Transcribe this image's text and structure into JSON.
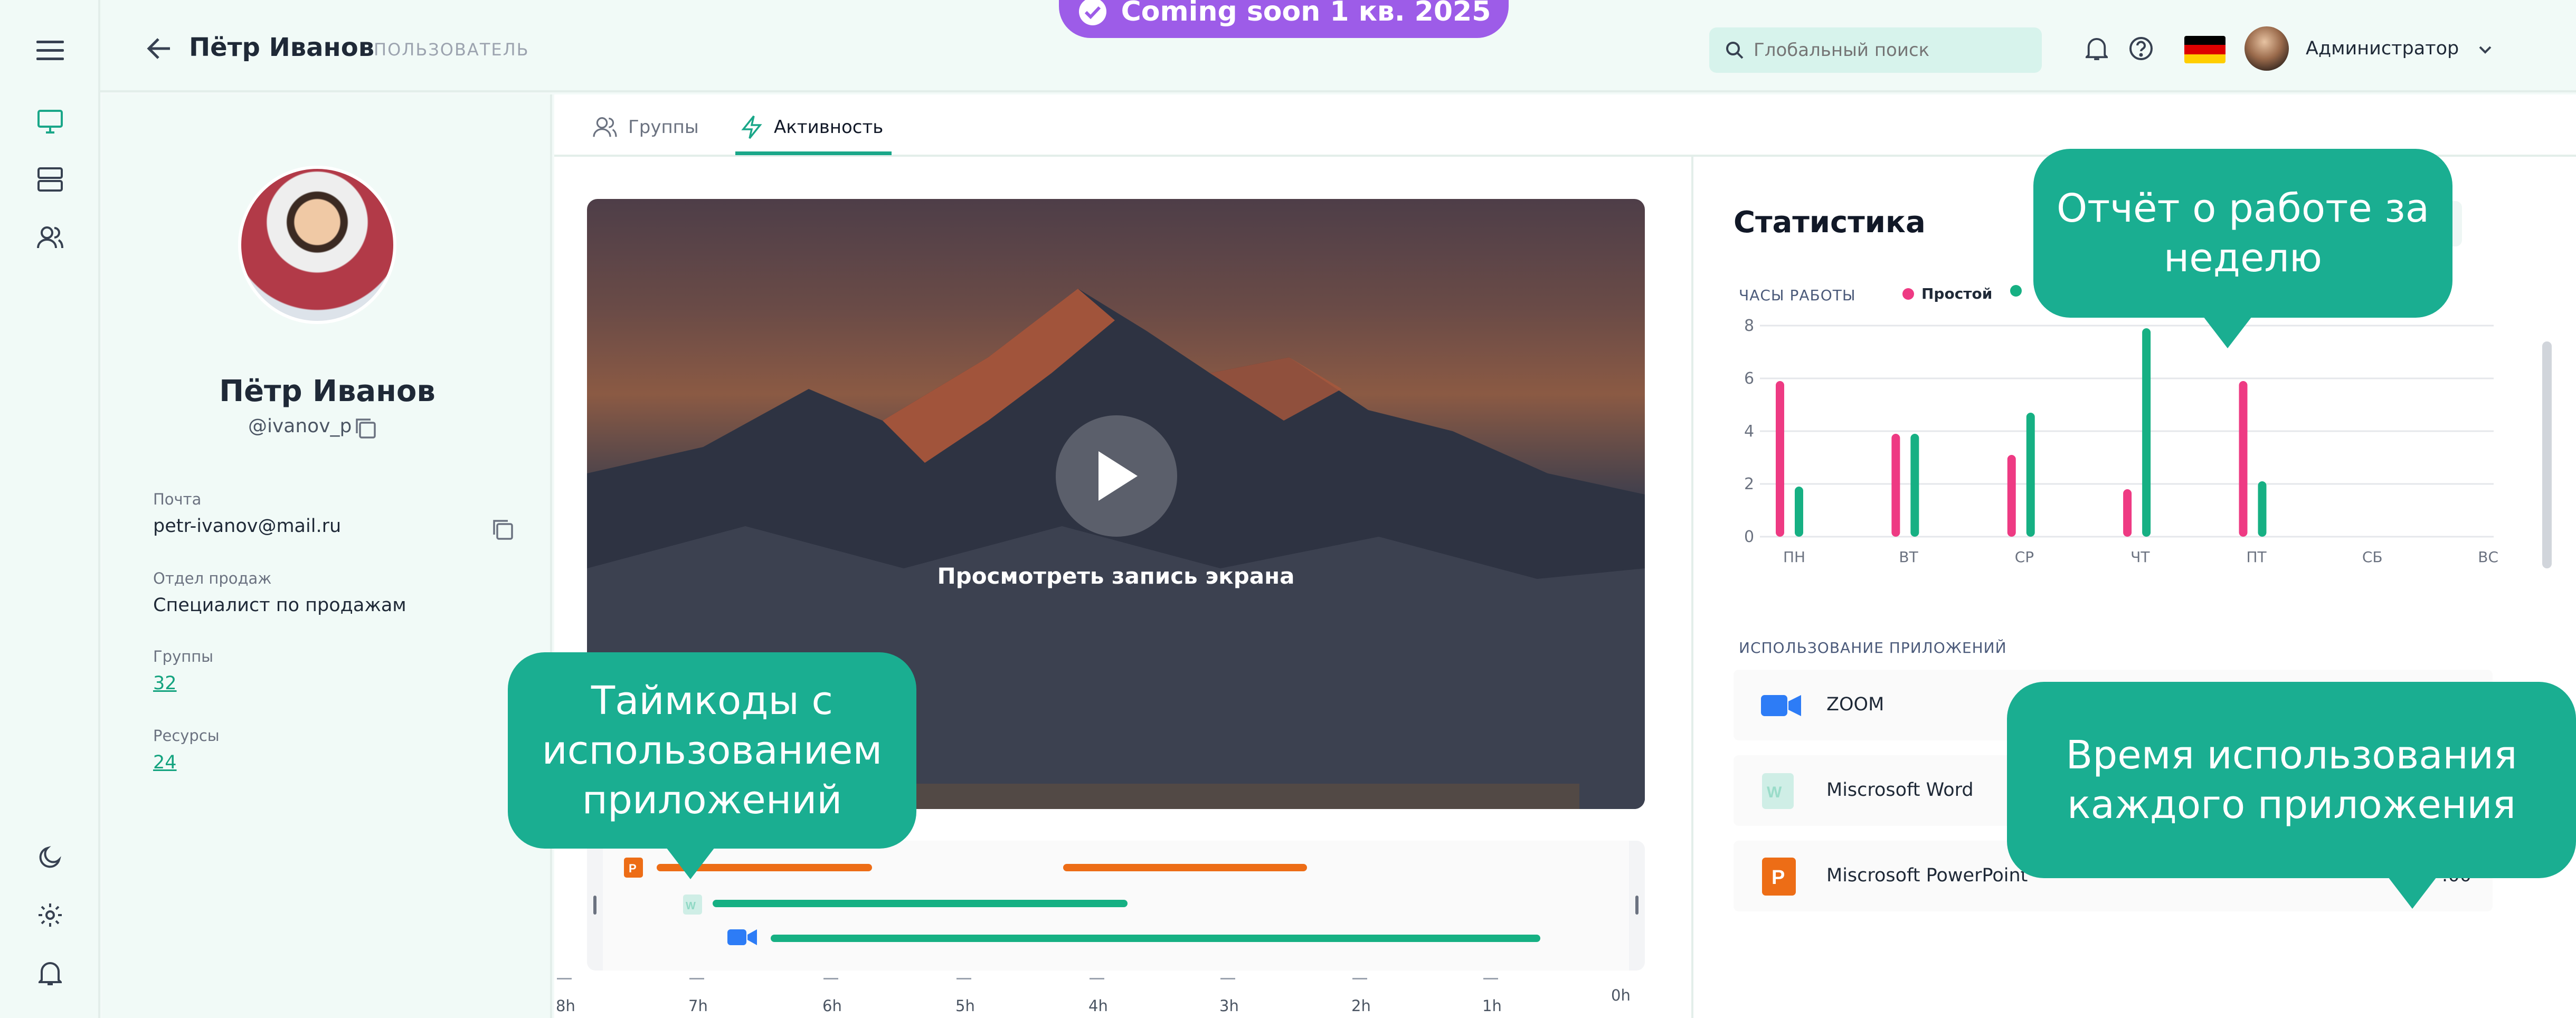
{
  "promo": {
    "label": "Coming soon 1 кв. 2025"
  },
  "header": {
    "user_name": "Пётр Иванов",
    "user_role": "ПОЛЬЗОВАТЕЛЬ",
    "search_placeholder": "Глобальный поиск",
    "account_name": "Администратор",
    "flag_colors": [
      "#000000",
      "#dd0000",
      "#ffce00"
    ]
  },
  "sidebar": {
    "icons": [
      "menu-icon",
      "monitor-icon",
      "server-icon",
      "users-icon",
      "moon-icon",
      "settings-icon",
      "bell-icon"
    ]
  },
  "profile": {
    "name": "Пётр Иванов",
    "handle": "@ivanov_p",
    "fields": [
      {
        "label": "Почта",
        "value": "petr-ivanov@mail.ru"
      },
      {
        "label": "Отдел продаж",
        "value": "Специалист по продажам"
      },
      {
        "label": "Группы",
        "value": "32"
      },
      {
        "label": "Ресурсы",
        "value": "24"
      }
    ]
  },
  "tabs": [
    {
      "label": "Группы",
      "active": false
    },
    {
      "label": "Активность",
      "active": true
    }
  ],
  "video": {
    "caption": "Просмотреть запись экрана"
  },
  "timeline": {
    "ticks": [
      "8h",
      "7h",
      "6h",
      "5h",
      "4h",
      "3h",
      "2h",
      "1h",
      "0h"
    ],
    "tracks": [
      {
        "app": "powerpoint-icon",
        "color": "#ed6d16"
      },
      {
        "app": "word-icon",
        "color": "#16b083"
      },
      {
        "app": "zoom-icon",
        "color": "#16b083"
      }
    ]
  },
  "stats": {
    "title": "Статистика",
    "hours_label": "ЧАСЫ РАБОТЫ",
    "legend": [
      {
        "name": "Простой",
        "color": "#ee3a83"
      }
    ],
    "apps_label": "ИСПОЛЬЗОВАНИЕ ПРИЛОЖЕНИЙ",
    "apps": [
      {
        "name": "ZOOM",
        "time": ""
      },
      {
        "name": "Miscrosoft Word",
        "time": ""
      },
      {
        "name": "Miscrosoft PowerPoint",
        "time": ":00"
      }
    ]
  },
  "chart_data": {
    "type": "bar",
    "categories": [
      "ПН",
      "ВТ",
      "СР",
      "ЧТ",
      "ПТ",
      "СБ",
      "ВС"
    ],
    "series": [
      {
        "name": "Простой",
        "color": "#ee3a83",
        "values": [
          5.9,
          3.9,
          3.1,
          1.8,
          5.9,
          0,
          0
        ]
      },
      {
        "color": "#16b083",
        "values": [
          1.9,
          3.9,
          4.7,
          7.9,
          2.1,
          0,
          0
        ]
      }
    ],
    "yticks": [
      "0",
      "2",
      "4",
      "6",
      "8"
    ],
    "ylim": [
      0,
      8
    ],
    "grid": true
  },
  "callouts": {
    "weekly": "Отчёт о работе за неделю",
    "timecodes": "Таймкоды с использованием приложений",
    "usage": "Время использования каждого приложения"
  }
}
